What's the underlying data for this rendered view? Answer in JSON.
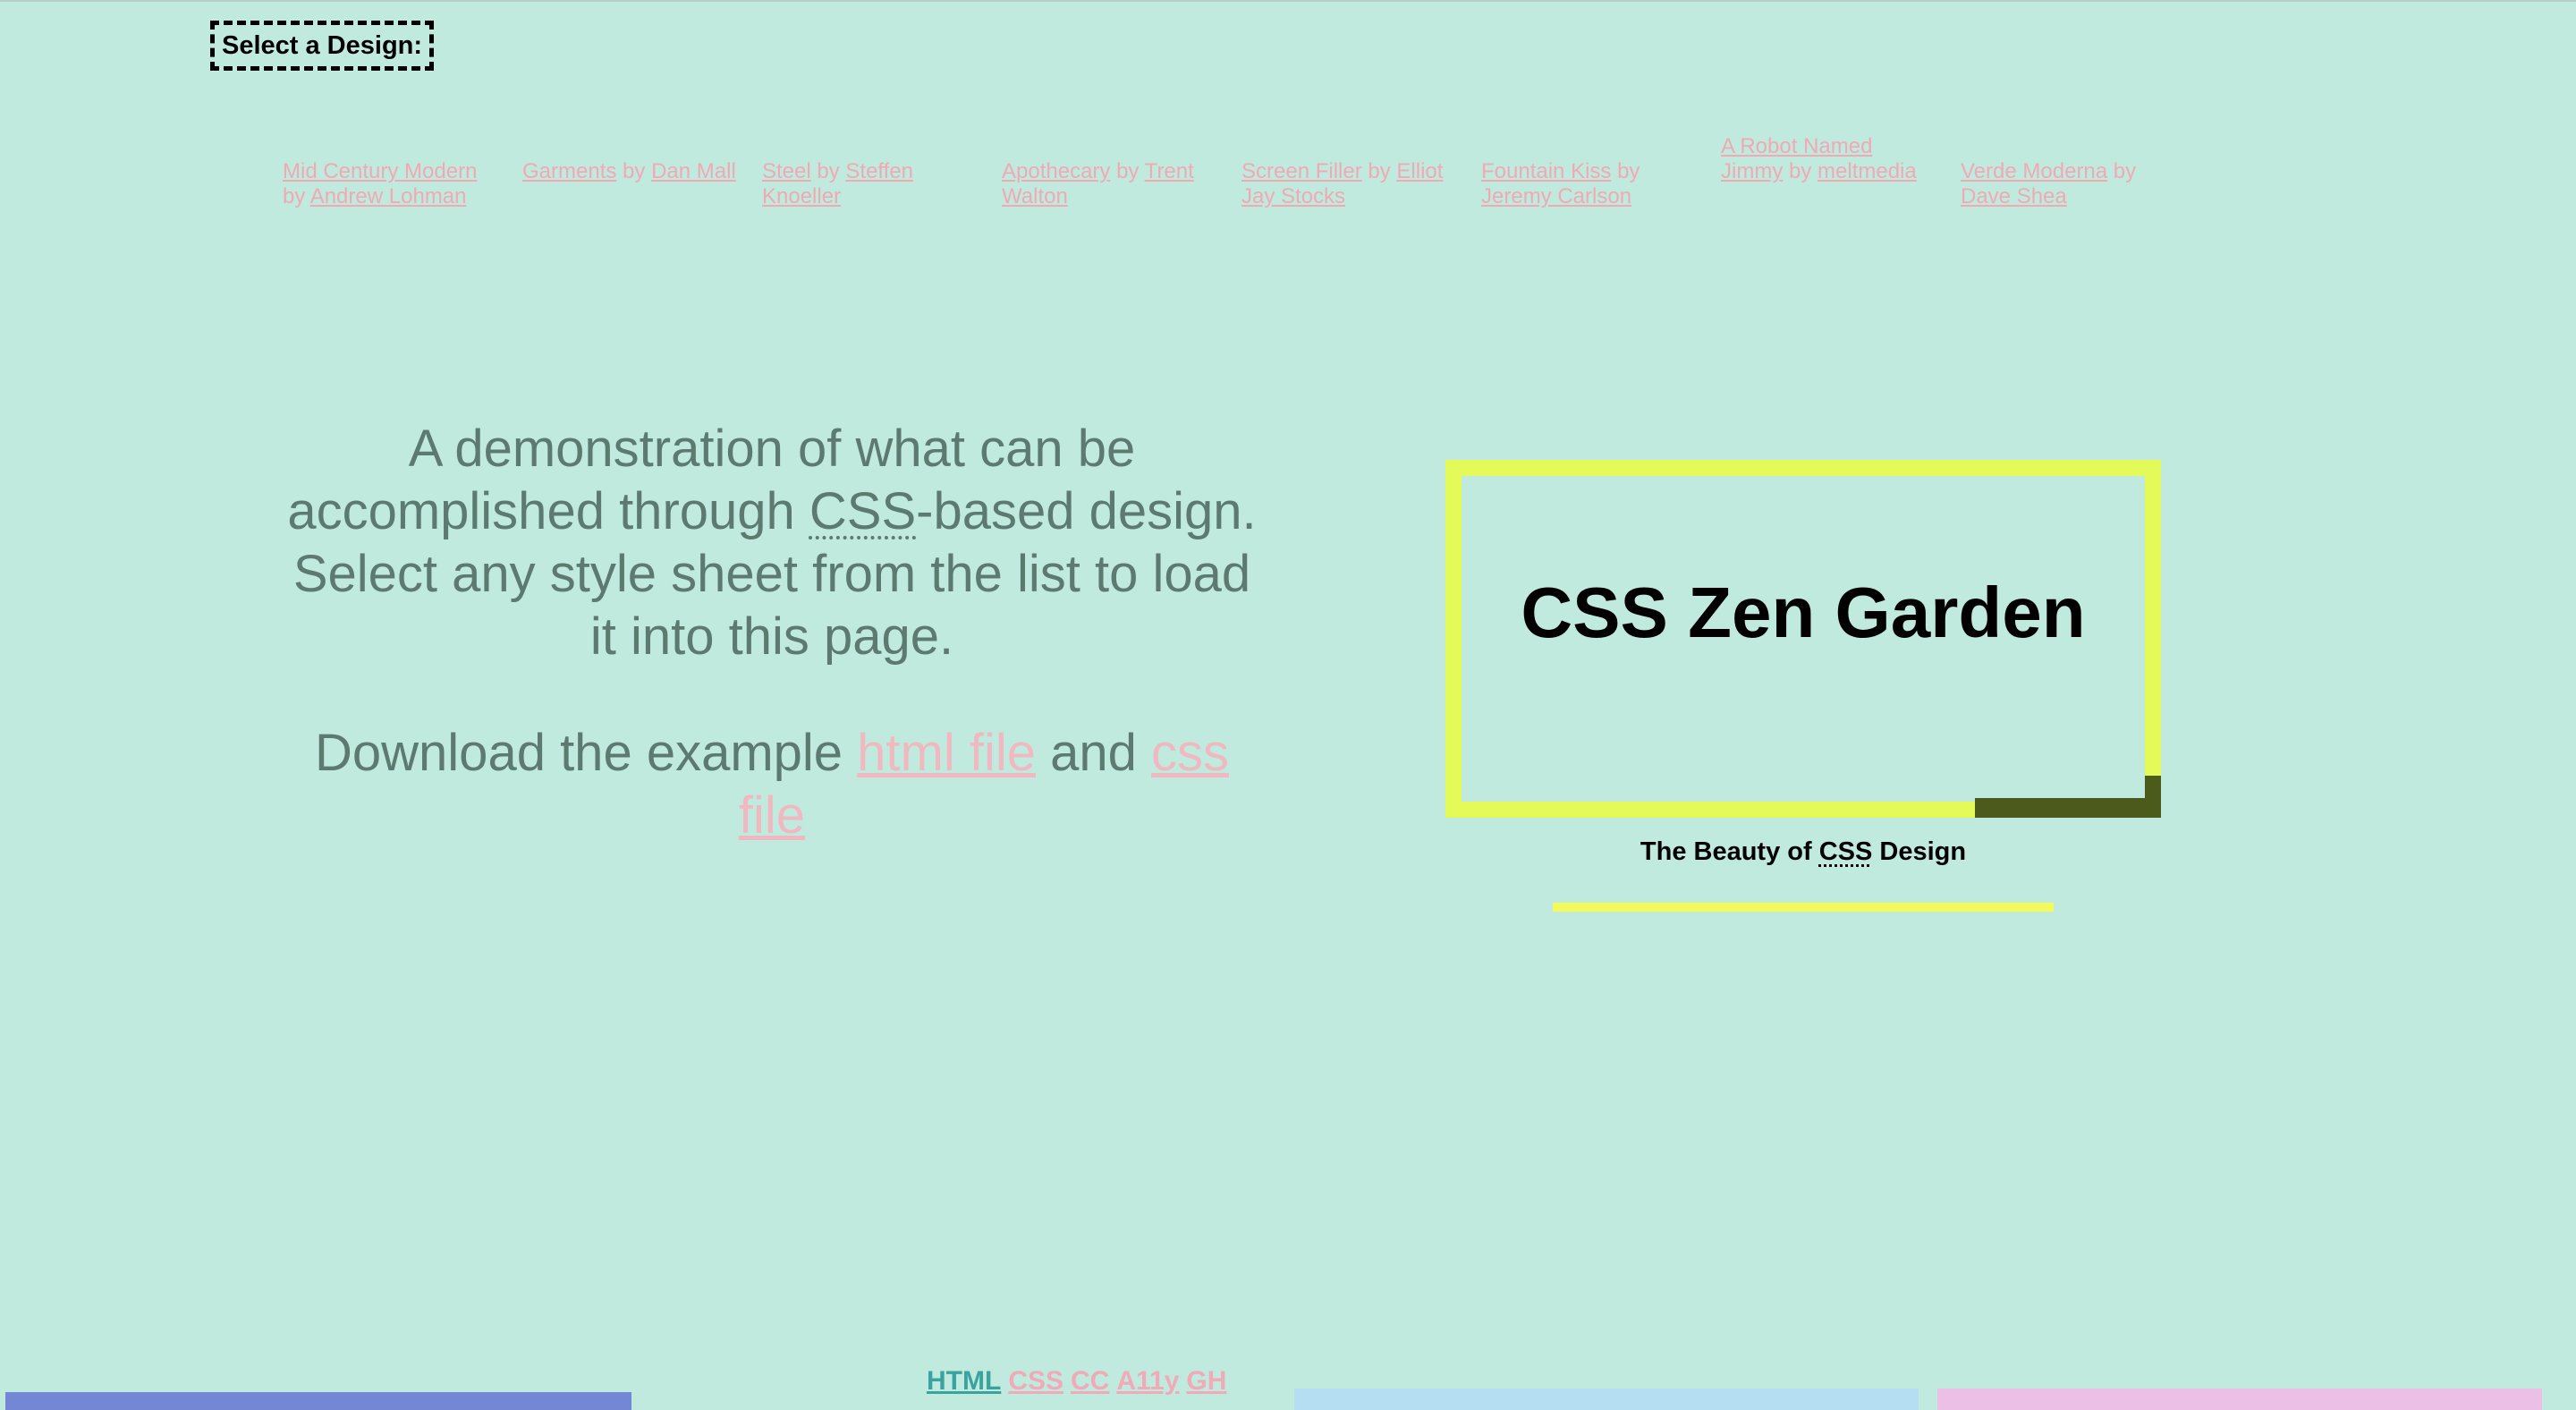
{
  "select_label": "Select a Design:",
  "designs": [
    {
      "name": "Mid Century Modern",
      "by": "by",
      "author": "Andrew Lohman"
    },
    {
      "name": "Garments",
      "by": "by",
      "author": "Dan Mall"
    },
    {
      "name": "Steel",
      "by": "by",
      "author": "Steffen Knoeller"
    },
    {
      "name": "Apothecary",
      "by": "by",
      "author": "Trent Walton"
    },
    {
      "name": "Screen Filler",
      "by": "by",
      "author": "Elliot Jay Stocks"
    },
    {
      "name": "Fountain Kiss",
      "by": "by",
      "author": "Jeremy Carlson"
    },
    {
      "name": "A Robot Named Jimmy",
      "by": "by",
      "author": "meltmedia"
    },
    {
      "name": "Verde Moderna",
      "by": "by",
      "author": "Dave Shea"
    }
  ],
  "intro": {
    "line_pre": "A demonstration of what can be accomplished through ",
    "abbr": "CSS",
    "line_post": "-based design. Select any style sheet from the list to load it into this page.",
    "download_pre": "Download the example ",
    "html_link": "html file",
    "and": " and ",
    "css_link": "css file"
  },
  "title": "CSS Zen Garden",
  "tagline": {
    "pre": "The Beauty of ",
    "abbr": "CSS",
    "post": " Design"
  },
  "footer": {
    "html": "HTML",
    "css": "CSS",
    "cc": "CC",
    "a11y": "A11y",
    "gh": "GH"
  },
  "colors": {
    "background": "#c0eadd",
    "frame": "#e3fa58",
    "link": "#f1a9b6",
    "intro_text": "#5c7a70"
  }
}
